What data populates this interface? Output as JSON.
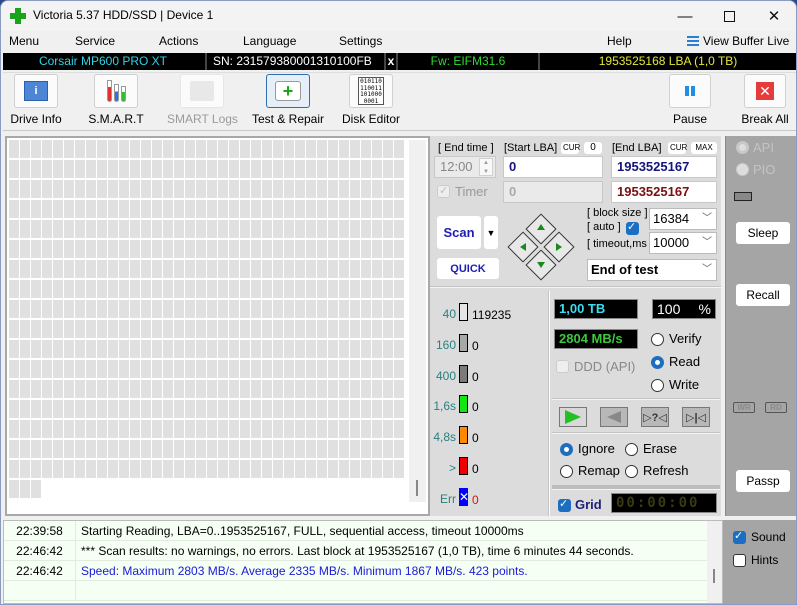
{
  "window": {
    "title": "Victoria 5.37 HDD/SSD | Device 1",
    "controls": {
      "minimize": "—",
      "maximize": "",
      "close": "✕"
    }
  },
  "menu": {
    "items": [
      "Menu",
      "Service",
      "Actions",
      "Language",
      "Settings",
      "Help"
    ],
    "view_buffer_live": "View Buffer Live"
  },
  "device": {
    "model": "Corsair MP600 PRO XT",
    "serial": "SN: 231579380001310100FB",
    "close": "x",
    "firmware": "Fw: EIFM31.6",
    "capacity": "1953525168 LBA (1,0 TB)"
  },
  "toolbar": {
    "buttons": [
      {
        "label": "Drive Info",
        "icon": "info-icon",
        "state": "normal"
      },
      {
        "label": "S.M.A.R.T",
        "icon": "test-tubes-icon",
        "state": "normal"
      },
      {
        "label": "SMART Logs",
        "icon": "folder-icon",
        "state": "disabled"
      },
      {
        "label": "Test & Repair",
        "icon": "first-aid-kit-icon",
        "state": "active"
      },
      {
        "label": "Disk Editor",
        "icon": "binary-file-icon",
        "state": "normal"
      }
    ],
    "binary_text": "010110\n110011\n101000\n0001",
    "pause": "Pause",
    "break_all": "Break All"
  },
  "scan": {
    "end_time_label": "[ End time ]",
    "end_time_value": "12:00",
    "start_lba_label": "[Start LBA]",
    "start_cur": "CUR",
    "start_cur_value": "0",
    "start_lba": "0",
    "start_lba_2": "0",
    "end_lba_label": "[End LBA]",
    "end_cur": "CUR",
    "end_max": "MAX",
    "end_lba": "1953525167",
    "end_lba_2": "1953525167",
    "timer_label": "Timer",
    "timer_checked": true,
    "scan_button": "Scan",
    "quick_button": "QUICK",
    "block_size_label": "[ block size ]",
    "auto_label": "[ auto ]",
    "auto_checked": true,
    "block_size": "16384",
    "timeout_label": "[ timeout,ms ]",
    "timeout": "10000",
    "end_action": "End of test"
  },
  "legend": [
    {
      "label": "40",
      "color": "#e6e6e6",
      "count": "119235"
    },
    {
      "label": "160",
      "color": "#a8a8a8",
      "count": "0"
    },
    {
      "label": "400",
      "color": "#7a7a7a",
      "count": "0"
    },
    {
      "label": "1,6s",
      "color": "#14e614",
      "count": "0"
    },
    {
      "label": "4,8s",
      "color": "#ff8a00",
      "count": "0"
    },
    {
      "label": ">",
      "color": "#f00000",
      "count": "0"
    },
    {
      "label": "Err",
      "color": "#0000ff",
      "count": "0"
    }
  ],
  "stats": {
    "size": "1,00 TB",
    "percent": "100",
    "percent_sign": "%",
    "speed": "2804 MB/s",
    "ddd_label": "DDD (API)",
    "modes": [
      {
        "label": "Verify",
        "selected": false
      },
      {
        "label": "Read",
        "selected": true
      },
      {
        "label": "Write",
        "selected": false
      }
    ],
    "transport": [
      "play",
      "reverse",
      "seek-random",
      "seek-end"
    ],
    "transport_glyphs": {
      "seek_random": "▷?◁",
      "seek_end": "▷|◁"
    },
    "actions": [
      {
        "label": "Ignore",
        "selected": true
      },
      {
        "label": "Erase",
        "selected": false
      },
      {
        "label": "Remap",
        "selected": false
      },
      {
        "label": "Refresh",
        "selected": false
      }
    ],
    "grid_label": "Grid",
    "grid_checked": true,
    "elapsed": "00:00:00"
  },
  "side": {
    "api": "API",
    "pio": "PIO",
    "sleep": "Sleep",
    "recall": "Recall",
    "wr": "WR",
    "rd": "RD",
    "passp": "Passp",
    "sound": "Sound",
    "sound_checked": true,
    "hints": "Hints",
    "hints_checked": false
  },
  "grid": {
    "completed_blocks": 615
  },
  "log": [
    {
      "time": "22:39:58",
      "message": "Starting Reading, LBA=0..1953525167, FULL, sequential access, timeout 10000ms",
      "color": "#000000"
    },
    {
      "time": "22:46:42",
      "message": "*** Scan results: no warnings, no errors. Last block at 1953525167 (1,0 TB), time 6 minutes 44 seconds.",
      "color": "#000000"
    },
    {
      "time": "22:46:42",
      "message": "Speed: Maximum 2803 MB/s. Average 2335 MB/s. Minimum 1867 MB/s. 423 points.",
      "color": "#1a1ad8"
    }
  ]
}
